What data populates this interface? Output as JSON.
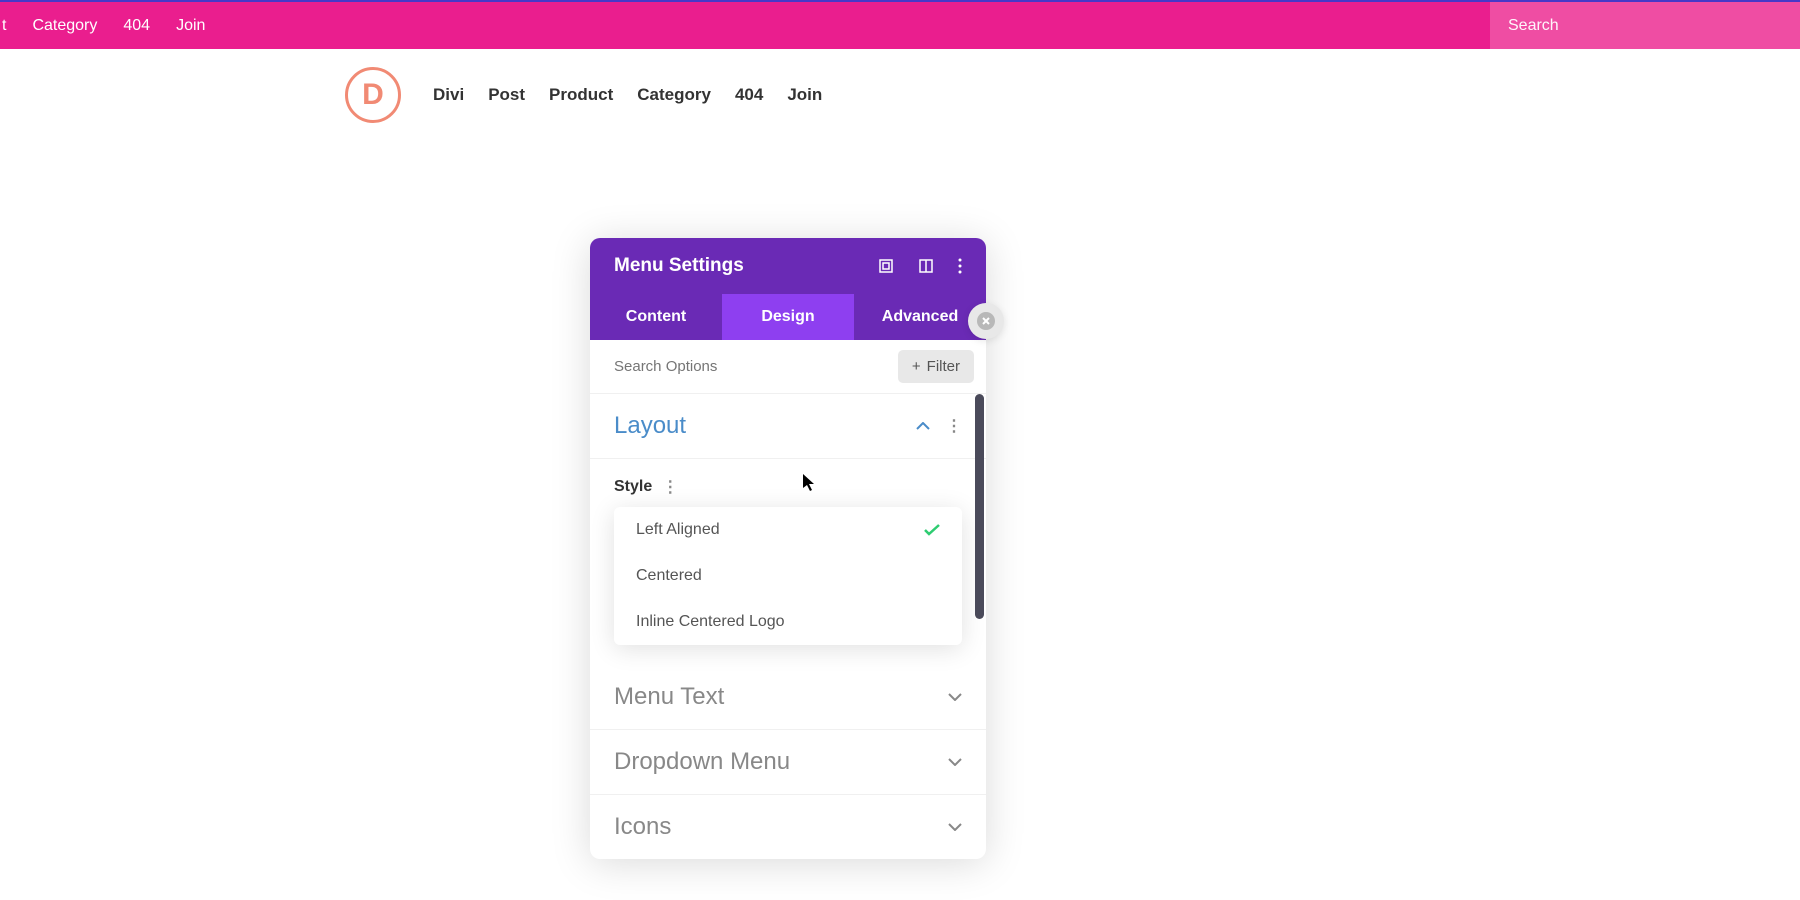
{
  "topBar": {},
  "pinkNav": {
    "partial": "t",
    "items": [
      "Category",
      "404",
      "Join"
    ],
    "search": {
      "placeholder": "Search"
    }
  },
  "mainNav": {
    "logo": "D",
    "items": [
      "Divi",
      "Post",
      "Product",
      "Category",
      "404",
      "Join"
    ]
  },
  "modal": {
    "title": "Menu Settings",
    "tabs": [
      "Content",
      "Design",
      "Advanced"
    ],
    "activeTab": 1,
    "searchOptions": {
      "placeholder": "Search Options"
    },
    "filter": "Filter",
    "sections": {
      "layout": {
        "title": "Layout",
        "style": {
          "label": "Style"
        },
        "options": [
          "Left Aligned",
          "Centered",
          "Inline Centered Logo"
        ],
        "selectedIndex": 0
      },
      "menuText": "Menu Text",
      "dropdownMenu": "Dropdown Menu",
      "icons": "Icons"
    }
  }
}
